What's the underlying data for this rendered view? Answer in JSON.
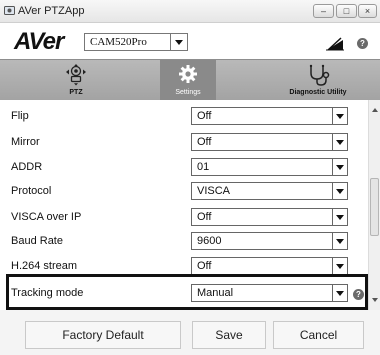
{
  "window": {
    "title": "AVer PTZApp"
  },
  "header": {
    "logo_text": "AVer",
    "camera_model": "CAM520Pro",
    "help_label": "?"
  },
  "tabs": [
    {
      "label": "PTZ",
      "icon": "ptz-camera-icon",
      "active": false
    },
    {
      "label": "Settings",
      "icon": "gear-icon",
      "active": true
    },
    {
      "label": "Diagnostic Utility",
      "icon": "stethoscope-icon",
      "active": false
    }
  ],
  "settings": [
    {
      "label": "Flip",
      "value": "Off"
    },
    {
      "label": "Mirror",
      "value": "Off"
    },
    {
      "label": "ADDR",
      "value": "01"
    },
    {
      "label": "Protocol",
      "value": "VISCA"
    },
    {
      "label": "VISCA over IP",
      "value": "Off"
    },
    {
      "label": "Baud Rate",
      "value": "9600"
    },
    {
      "label": "H.264 stream",
      "value": "Off"
    },
    {
      "label": "Tracking mode",
      "value": "Manual",
      "highlighted": true
    }
  ],
  "buttons": {
    "factory_default": "Factory Default",
    "save": "Save",
    "cancel": "Cancel"
  },
  "colors": {
    "tab_bar": "#a9a9a9",
    "active_tab": "#8a8a8a",
    "highlight_border": "#111111"
  }
}
